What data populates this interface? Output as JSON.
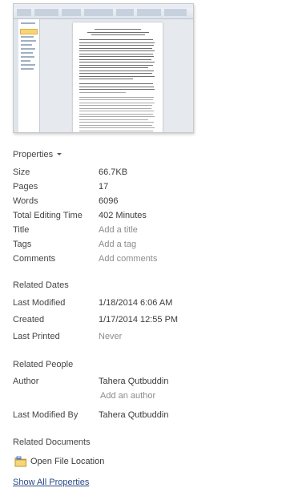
{
  "properties": {
    "header": "Properties",
    "rows": [
      {
        "label": "Size",
        "value": "66.7KB"
      },
      {
        "label": "Pages",
        "value": "17"
      },
      {
        "label": "Words",
        "value": "6096"
      },
      {
        "label": "Total Editing Time",
        "value": "402 Minutes"
      },
      {
        "label": "Title",
        "placeholder": "Add a title"
      },
      {
        "label": "Tags",
        "placeholder": "Add a tag"
      },
      {
        "label": "Comments",
        "placeholder": "Add comments"
      }
    ]
  },
  "related_dates": {
    "header": "Related Dates",
    "rows": [
      {
        "label": "Last Modified",
        "value": "1/18/2014 6:06 AM"
      },
      {
        "label": "Created",
        "value": "1/17/2014 12:55 PM"
      },
      {
        "label": "Last Printed",
        "value": "Never"
      }
    ]
  },
  "related_people": {
    "header": "Related People",
    "author_label": "Author",
    "author_value": "Tahera Qutbuddin",
    "add_author": "Add an author",
    "last_modified_by_label": "Last Modified By",
    "last_modified_by_value": "Tahera Qutbuddin"
  },
  "related_documents": {
    "header": "Related Documents",
    "open_file_location": "Open File Location",
    "folder_icon": "folder-icon"
  },
  "show_all_properties": "Show All Properties",
  "colors": {
    "link": "#2a4a86",
    "placeholder": "#8c8c8c",
    "label": "#444444"
  }
}
